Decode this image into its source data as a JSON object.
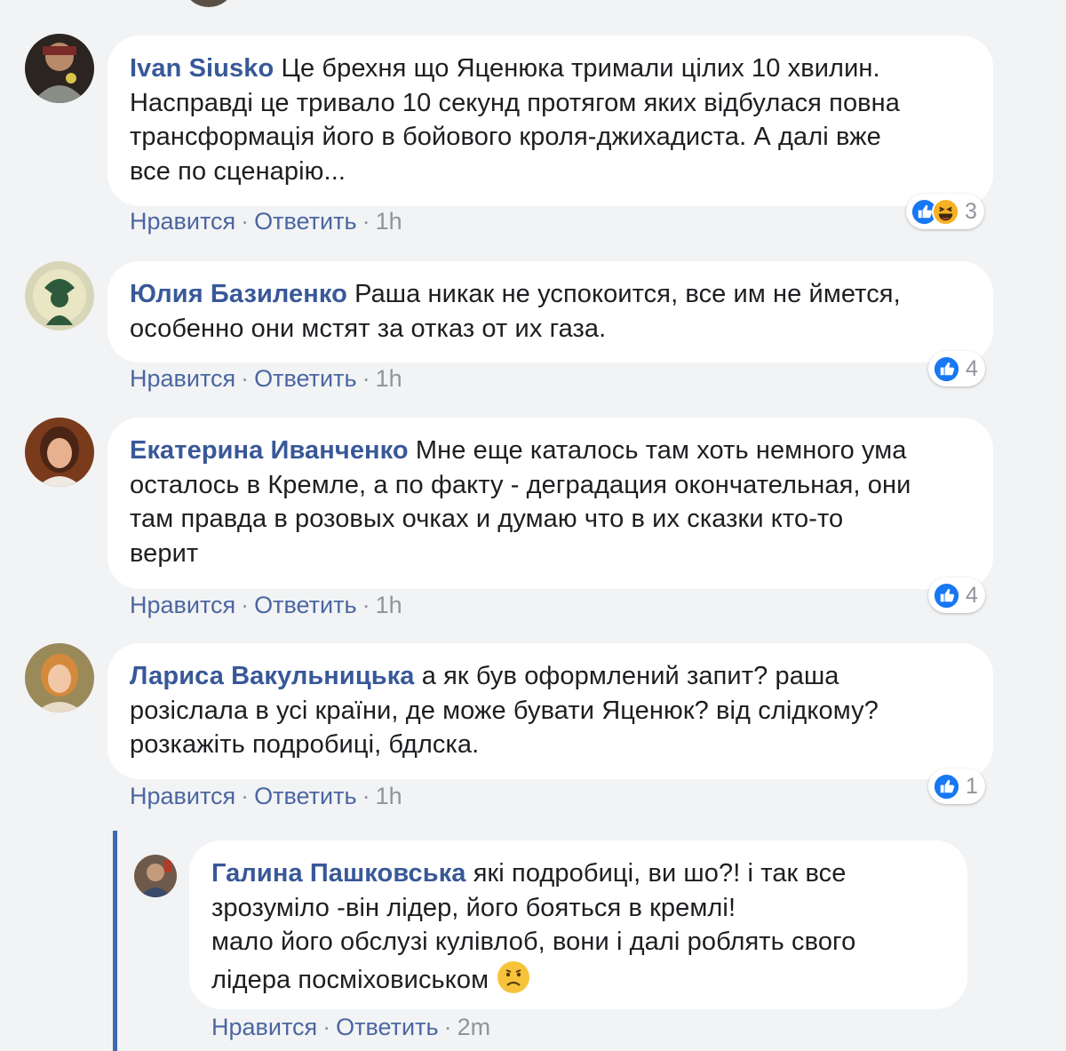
{
  "comments": [
    {
      "author": "Ivan Siusko",
      "text": "Це брехня що Яценюка тримали цілих 10 хвилин.\nНасправді це тривало 10 секунд протягом яких відбулася повна\nтрансформація його в бойового кроля-джихадиста. А далі вже\nвсе по сценарію...",
      "like_label": "Нравится",
      "reply_label": "Ответить",
      "time": "1h",
      "reactions": [
        "like",
        "haha"
      ],
      "reaction_count": "3"
    },
    {
      "author": "Юлия Базиленко",
      "text": "Раша никак не успокоится, все им не ймется,\nособенно они мстят за отказ от их газа.",
      "like_label": "Нравится",
      "reply_label": "Ответить",
      "time": "1h",
      "reactions": [
        "like"
      ],
      "reaction_count": "4"
    },
    {
      "author": "Екатерина Иванченко",
      "text": "Мне еще каталось там хоть немного ума\nосталось в Кремле, а по факту - деградация окончательная, они\nтам правда в розовых очках и думаю что в их сказки кто-то\nверит",
      "like_label": "Нравится",
      "reply_label": "Ответить",
      "time": "1h",
      "reactions": [
        "like"
      ],
      "reaction_count": "4"
    },
    {
      "author": "Лариса Вакульницька",
      "text": "а як був оформлений запит? раша\nрозіслала в усі країни, де може бувати Яценюк? від слідкому?\nрозкажіть подробиці, бдлска.",
      "like_label": "Нравится",
      "reply_label": "Ответить",
      "time": "1h",
      "reactions": [
        "like"
      ],
      "reaction_count": "1"
    }
  ],
  "reply": {
    "author": "Галина Пашковська",
    "text": "які подробиці, ви шо?! і так все\nзрозуміло -він лідер, його бояться в кремлі!\nмало його обслузі кулівлоб, вони і далі роблять свого\nлідера посміховиськом",
    "inline_emoji": "worried-face-icon",
    "like_label": "Нравится",
    "reply_label": "Ответить",
    "time": "2m"
  },
  "colors": {
    "background": "#f2f3f5",
    "bubble": "#ffffff",
    "author": "#385898",
    "action_link": "#4b67a1",
    "meta": "#90949c",
    "like_blue": "#1877f2",
    "reply_rail": "#4267b2"
  }
}
